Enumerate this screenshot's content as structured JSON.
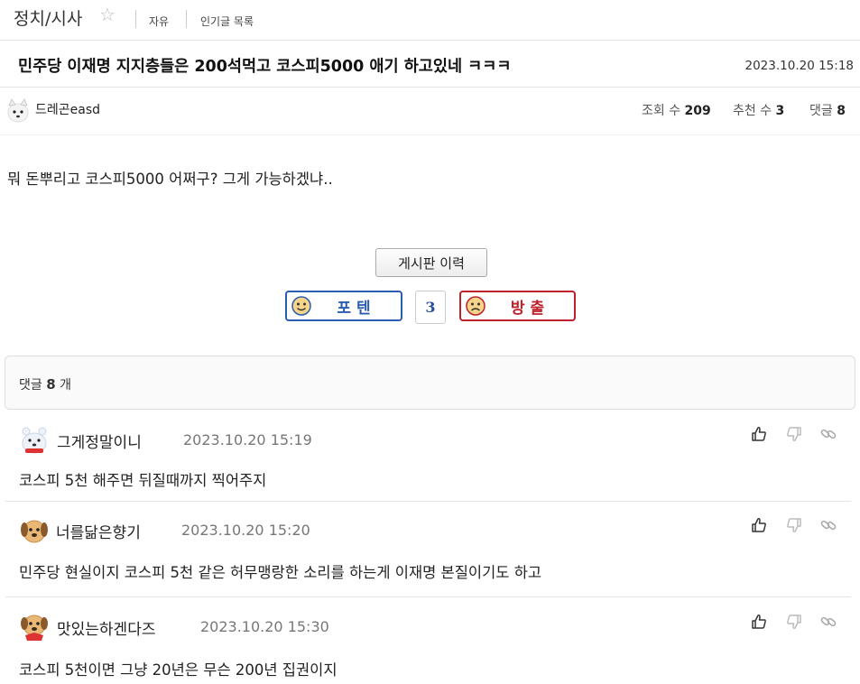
{
  "board": {
    "title": "정치/시사",
    "links": [
      "자유",
      "인기글 목록"
    ]
  },
  "post": {
    "title": "민주당 이재명 지지층들은 200석먹고 코스피5000 애기 하고있네 ㅋㅋㅋ",
    "date": "2023.10.20 15:18",
    "author": "드레곤easd",
    "stats": {
      "views_label": "조회 수",
      "views": "209",
      "likes_label": "추천 수",
      "likes": "3",
      "comments_label": "댓글",
      "comments": "8"
    },
    "content": "뭐 돈뿌리고 코스피5000 어쩌구?  그게 가능하겠냐.."
  },
  "buttons": {
    "history": "게시판 이력",
    "upvote": "포텐",
    "downvote": "방출",
    "vote_count": "3"
  },
  "comments_header": {
    "prefix": "댓글",
    "count": "8",
    "suffix": "개"
  },
  "comments": [
    {
      "name": "그게정말이니",
      "date": "2023.10.20 15:19",
      "body": "코스피 5천 해주면 뒤질때까지 찍어주지"
    },
    {
      "name": "너를닮은향기",
      "date": "2023.10.20 15:20",
      "body": "민주당 현실이지 코스피 5천 같은 허무맹랑한 소리를 하는게 이재명 본질이기도 하고"
    },
    {
      "name": "맛있는하겐다즈",
      "date": "2023.10.20 15:30",
      "body": "코스피 5천이면 그냥 20년은 무슨 200년 집권이지"
    }
  ],
  "icons": {
    "favorite": "star-outline-icon",
    "like": "thumbs-up-icon",
    "dislike": "thumbs-down-icon",
    "link": "link-icon"
  },
  "colors": {
    "upvote": "#2a5db0",
    "downvote": "#c0202a"
  }
}
